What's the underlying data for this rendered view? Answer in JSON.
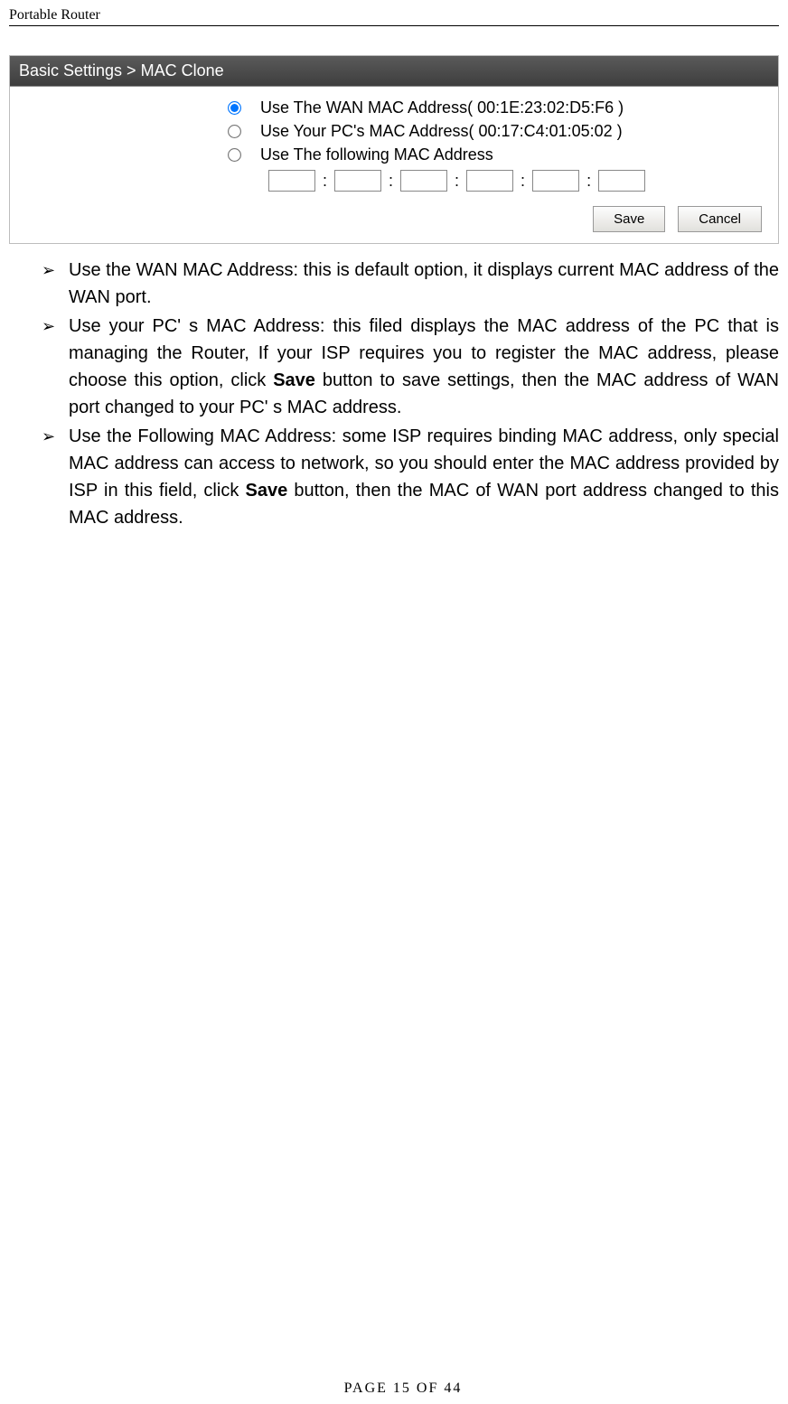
{
  "header": {
    "title": "Portable Router"
  },
  "panel": {
    "title": "Basic Settings > MAC Clone",
    "options": {
      "opt1": "Use The WAN MAC Address( 00:1E:23:02:D5:F6 )",
      "opt2": "Use Your PC's MAC Address( 00:17:C4:01:05:02 )",
      "opt3": "Use The following MAC Address"
    },
    "mac_fields": [
      "",
      "",
      "",
      "",
      "",
      ""
    ],
    "buttons": {
      "save": "Save",
      "cancel": "Cancel"
    }
  },
  "bullets": {
    "b1_pre": "Use the WAN MAC Address: this is default option, it displays current MAC address of the WAN port.",
    "b2_pre": "Use your PC' s MAC Address: this filed displays the MAC address of the PC that is managing the Router, If your ISP requires you to register the MAC address, please choose this option,   click ",
    "b2_bold": "Save",
    "b2_post": " button to save settings, then the MAC address of WAN port changed to your PC' s MAC address.",
    "b3_pre": "Use the Following MAC Address: some ISP requires binding MAC address, only special MAC address can access to network, so you should enter the MAC address provided by ISP in this field, click ",
    "b3_bold": "Save",
    "b3_post": " button, then the MAC of WAN port address changed to this MAC address."
  },
  "footer": {
    "text": "PAGE   15   OF   44"
  },
  "bullet_glyph": "➢"
}
